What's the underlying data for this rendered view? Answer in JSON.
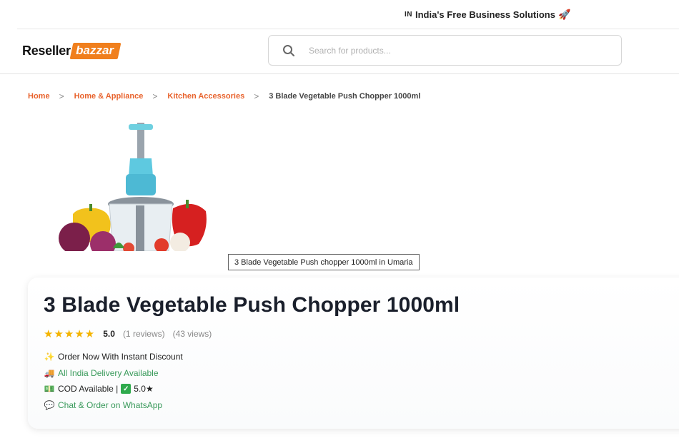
{
  "topbar": {
    "flag": "IN",
    "text": "India's Free Business Solutions",
    "rocket_icon": "rocket-icon"
  },
  "logo": {
    "part1": "Reseller",
    "part2": "bazzar",
    "accent": "#f07f1d"
  },
  "search": {
    "placeholder": "Search for products..."
  },
  "breadcrumb": {
    "items": [
      "Home",
      "Home & Appliance",
      "Kitchen Accessories"
    ],
    "current": "3 Blade Vegetable Push Chopper 1000ml",
    "link_color": "#e8622c"
  },
  "image": {
    "tooltip": "3 Blade Vegetable Push chopper 1000ml in Umaria"
  },
  "product": {
    "title": "3 Blade Vegetable Push Chopper 1000ml",
    "stars": "★★★★★",
    "rating": "5.0",
    "reviews": "(1 reviews)",
    "views": "(43 views)",
    "features": {
      "discount": "Order Now With Instant Discount",
      "delivery": "All India Delivery Available",
      "cod": "COD Available |",
      "cod_rating": "5.0★",
      "whatsapp": "Chat & Order on WhatsApp"
    },
    "green": "#3a9a5b",
    "star_color": "#f4b400"
  }
}
